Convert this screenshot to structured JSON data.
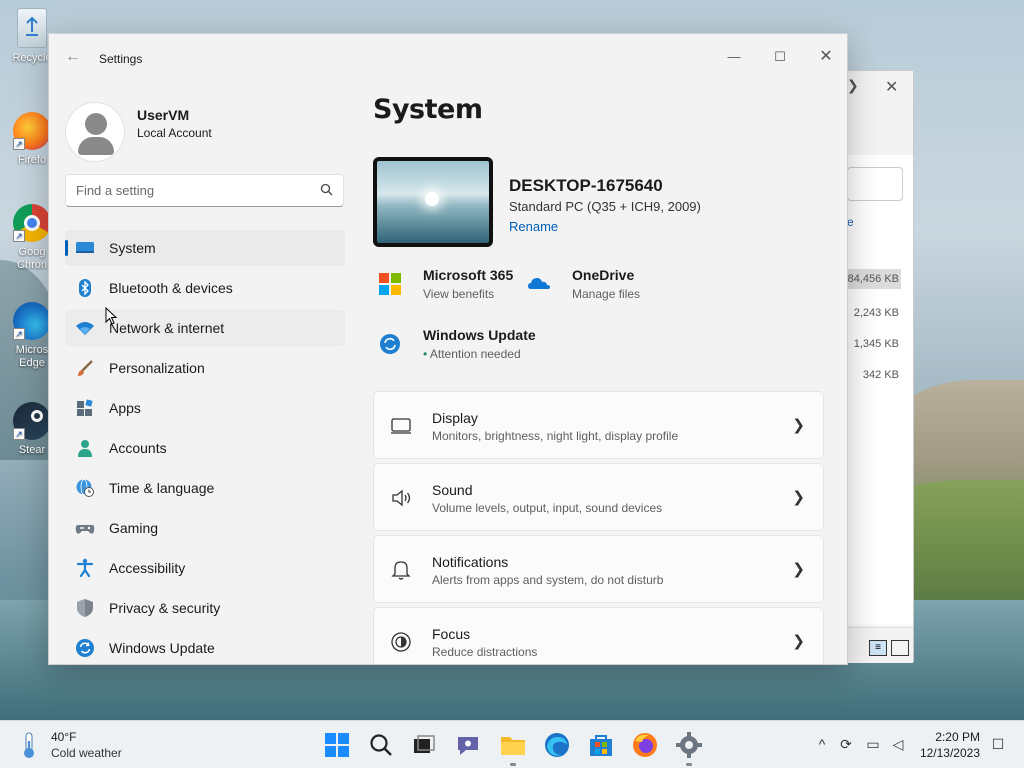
{
  "desktop": {
    "icons": [
      {
        "label": "Recycle"
      },
      {
        "label": "Firefo"
      },
      {
        "label": "Goog Chron"
      },
      {
        "label": "Micros Edge"
      },
      {
        "label": "Stear"
      }
    ]
  },
  "background_window": {
    "link_text": "e",
    "sizes": [
      "84,456 KB",
      "2,243 KB",
      "1,345 KB",
      "342 KB"
    ]
  },
  "settings": {
    "window_title": "Settings",
    "profile": {
      "name": "UserVM",
      "account_type": "Local Account"
    },
    "search": {
      "placeholder": "Find a setting"
    },
    "nav": [
      {
        "label": "System",
        "icon": "system-icon",
        "active": true
      },
      {
        "label": "Bluetooth & devices",
        "icon": "bluetooth-icon"
      },
      {
        "label": "Network & internet",
        "icon": "wifi-icon"
      },
      {
        "label": "Personalization",
        "icon": "brush-icon"
      },
      {
        "label": "Apps",
        "icon": "apps-icon"
      },
      {
        "label": "Accounts",
        "icon": "accounts-icon"
      },
      {
        "label": "Time & language",
        "icon": "globe-clock-icon"
      },
      {
        "label": "Gaming",
        "icon": "gamepad-icon"
      },
      {
        "label": "Accessibility",
        "icon": "accessibility-icon"
      },
      {
        "label": "Privacy & security",
        "icon": "shield-icon"
      },
      {
        "label": "Windows Update",
        "icon": "update-icon"
      }
    ],
    "main": {
      "title": "System",
      "device": {
        "name": "DESKTOP-1675640",
        "model": "Standard PC (Q35 + ICH9, 2009)",
        "rename": "Rename"
      },
      "quick": [
        {
          "title": "Microsoft 365",
          "subtitle": "View benefits",
          "icon": "microsoft-logo-icon"
        },
        {
          "title": "OneDrive",
          "subtitle": "Manage files",
          "icon": "onedrive-icon"
        },
        {
          "title": "Windows Update",
          "subtitle": "Attention needed",
          "icon": "update-icon"
        }
      ],
      "cards": [
        {
          "title": "Display",
          "subtitle": "Monitors, brightness, night light, display profile",
          "icon": "display-icon"
        },
        {
          "title": "Sound",
          "subtitle": "Volume levels, output, input, sound devices",
          "icon": "speaker-icon"
        },
        {
          "title": "Notifications",
          "subtitle": "Alerts from apps and system, do not disturb",
          "icon": "bell-icon"
        },
        {
          "title": "Focus",
          "subtitle": "Reduce distractions",
          "icon": "focus-icon"
        }
      ]
    },
    "accent_color": "#005fb8"
  },
  "taskbar": {
    "weather": {
      "temp": "40°F",
      "desc": "Cold weather"
    },
    "clock": {
      "time": "2:20 PM",
      "date": "12/13/2023"
    }
  }
}
